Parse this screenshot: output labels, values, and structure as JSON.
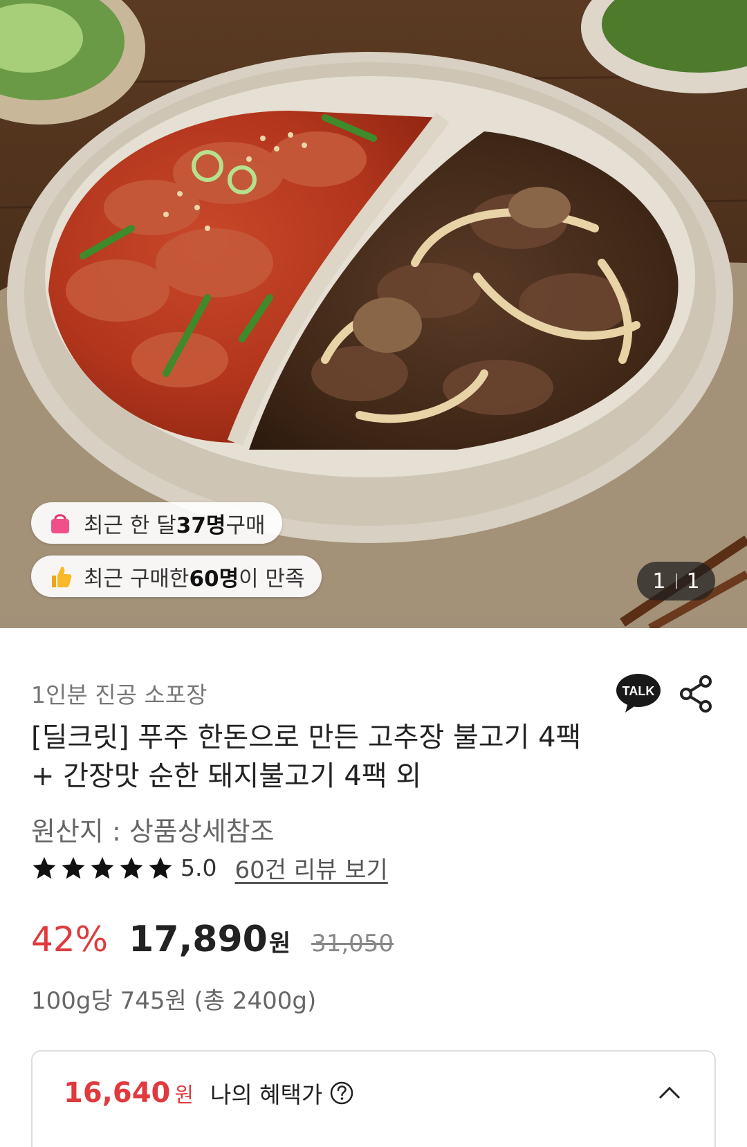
{
  "hero": {
    "badges": [
      {
        "prefix": "최근 한 달 ",
        "strong": "37명",
        "suffix": " 구매",
        "icon": "shopping-bag-icon"
      },
      {
        "prefix": "최근 구매한 ",
        "strong": "60명",
        "suffix": "이 만족",
        "icon": "thumbs-up-icon"
      }
    ],
    "counter": {
      "current": "1",
      "total": "1"
    }
  },
  "product": {
    "subtitle": "1인분 진공 소포장",
    "talk_label": "TALK",
    "title": "[딜크릿] 푸주 한돈으로 만든 고추장 불고기 4팩 + 간장맛 순한 돼지불고기 4팩 외",
    "origin": "원산지 : 상품상세참조",
    "rating": {
      "stars": 5,
      "score": "5.0",
      "review_link": "60건 리뷰 보기"
    },
    "price": {
      "discount": "42%",
      "sale": "17,890",
      "currency": "원",
      "original": "31,050",
      "unit_price": "100g당 745원 (총 2400g)"
    },
    "benefit": {
      "price": "16,640",
      "currency": "원",
      "label": "나의 혜택가"
    }
  },
  "colors": {
    "accent_red": "#e03a3e",
    "talk_bg": "#191919"
  }
}
